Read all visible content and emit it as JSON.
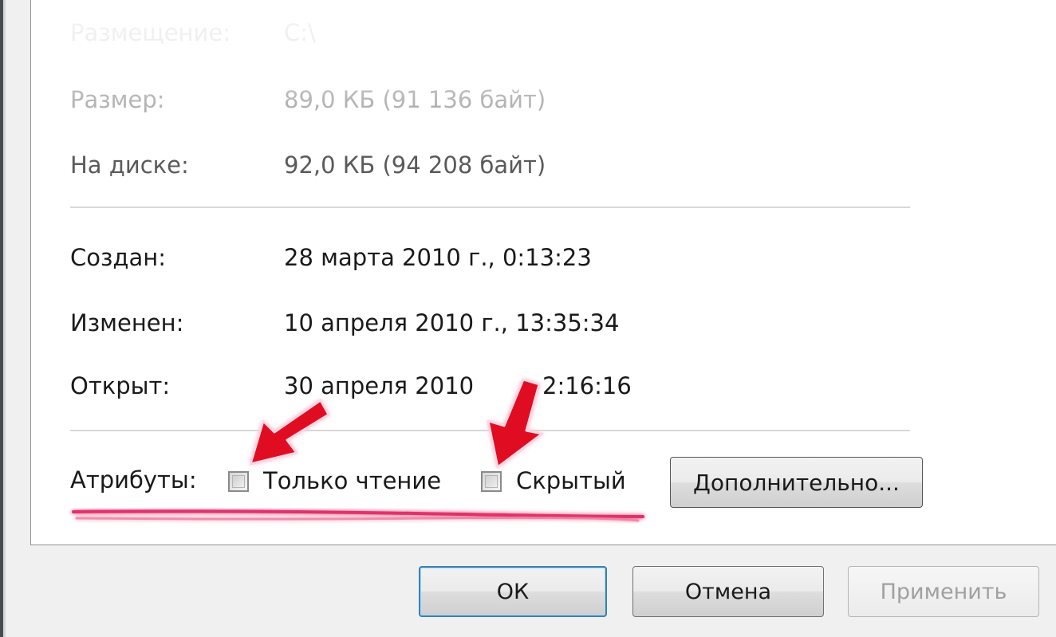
{
  "properties": {
    "location": {
      "label": "Размещение:",
      "value": "C:\\"
    },
    "size": {
      "label": "Размер:",
      "value": "89,0 КБ (91 136 байт)"
    },
    "on_disk": {
      "label": "На диске:",
      "value": "92,0 КБ (94 208 байт)"
    },
    "created": {
      "label": "Создан:",
      "value": "28 марта 2010 г., 0:13:23"
    },
    "modified": {
      "label": "Изменен:",
      "value": "10 апреля 2010 г., 13:35:34"
    },
    "accessed": {
      "label": "Открыт:",
      "value_start": "30 апреля 2010",
      "value_end": "2:16:16"
    }
  },
  "attributes": {
    "label": "Атрибуты:",
    "read_only": {
      "label": "Только чтение",
      "checked": false
    },
    "hidden": {
      "label": "Скрытый",
      "checked": false
    },
    "advanced_label": "Дополнительно..."
  },
  "buttons": {
    "ok": "ОК",
    "cancel": "Отмена",
    "apply": "Применить"
  },
  "colors": {
    "annotation_arrow": "#e01020",
    "annotation_underline": "#e0306a"
  }
}
